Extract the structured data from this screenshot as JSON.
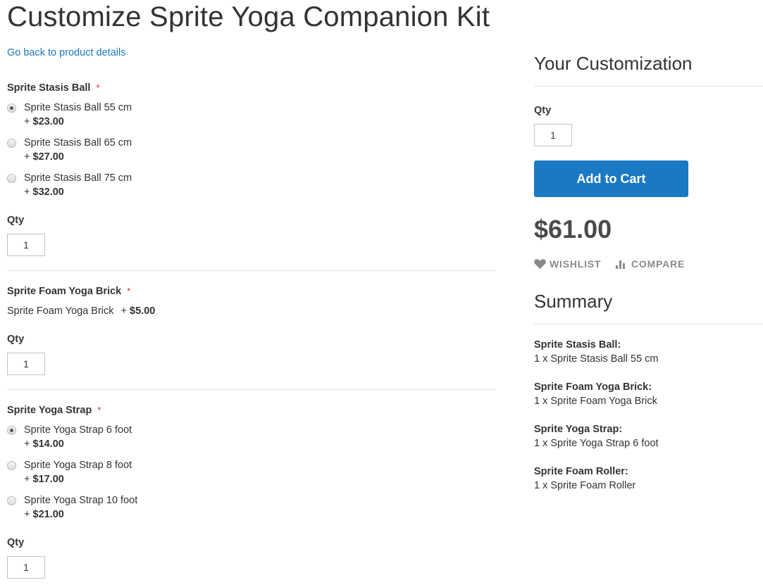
{
  "page": {
    "title": "Customize Sprite Yoga Companion Kit",
    "back_link": "Go back to product details"
  },
  "options": [
    {
      "title": "Sprite Stasis Ball",
      "required_mark": "*",
      "type": "radio",
      "choices": [
        {
          "label": "Sprite Stasis Ball 55 cm",
          "price_prefix": "+",
          "price": "$23.00",
          "checked": true
        },
        {
          "label": "Sprite Stasis Ball 65 cm",
          "price_prefix": "+",
          "price": "$27.00",
          "checked": false
        },
        {
          "label": "Sprite Stasis Ball 75 cm",
          "price_prefix": "+",
          "price": "$32.00",
          "checked": false
        }
      ],
      "qty_label": "Qty",
      "qty_value": "1"
    },
    {
      "title": "Sprite Foam Yoga Brick",
      "required_mark": "*",
      "type": "single",
      "choice": {
        "label": "Sprite Foam Yoga Brick",
        "price_prefix": "+",
        "price": "$5.00"
      },
      "qty_label": "Qty",
      "qty_value": "1"
    },
    {
      "title": "Sprite Yoga Strap",
      "required_mark": "*",
      "type": "radio",
      "choices": [
        {
          "label": "Sprite Yoga Strap 6 foot",
          "price_prefix": "+",
          "price": "$14.00",
          "checked": true
        },
        {
          "label": "Sprite Yoga Strap 8 foot",
          "price_prefix": "+",
          "price": "$17.00",
          "checked": false
        },
        {
          "label": "Sprite Yoga Strap 10 foot",
          "price_prefix": "+",
          "price": "$21.00",
          "checked": false
        }
      ],
      "qty_label": "Qty",
      "qty_value": "1"
    }
  ],
  "sidebar": {
    "heading": "Your Customization",
    "qty_label": "Qty",
    "qty_value": "1",
    "add_to_cart": "Add to Cart",
    "price": "$61.00",
    "wishlist": "WISHLIST",
    "compare": "COMPARE",
    "summary_heading": "Summary",
    "summary": [
      {
        "title": "Sprite Stasis Ball:",
        "value": "1 x Sprite Stasis Ball 55 cm"
      },
      {
        "title": "Sprite Foam Yoga Brick:",
        "value": "1 x Sprite Foam Yoga Brick"
      },
      {
        "title": "Sprite Yoga Strap:",
        "value": "1 x Sprite Yoga Strap 6 foot"
      },
      {
        "title": "Sprite Foam Roller:",
        "value": "1 x Sprite Foam Roller"
      }
    ]
  },
  "colors": {
    "accent": "#1979c3",
    "required": "#e02b27",
    "muted": "#8a8a8a"
  }
}
